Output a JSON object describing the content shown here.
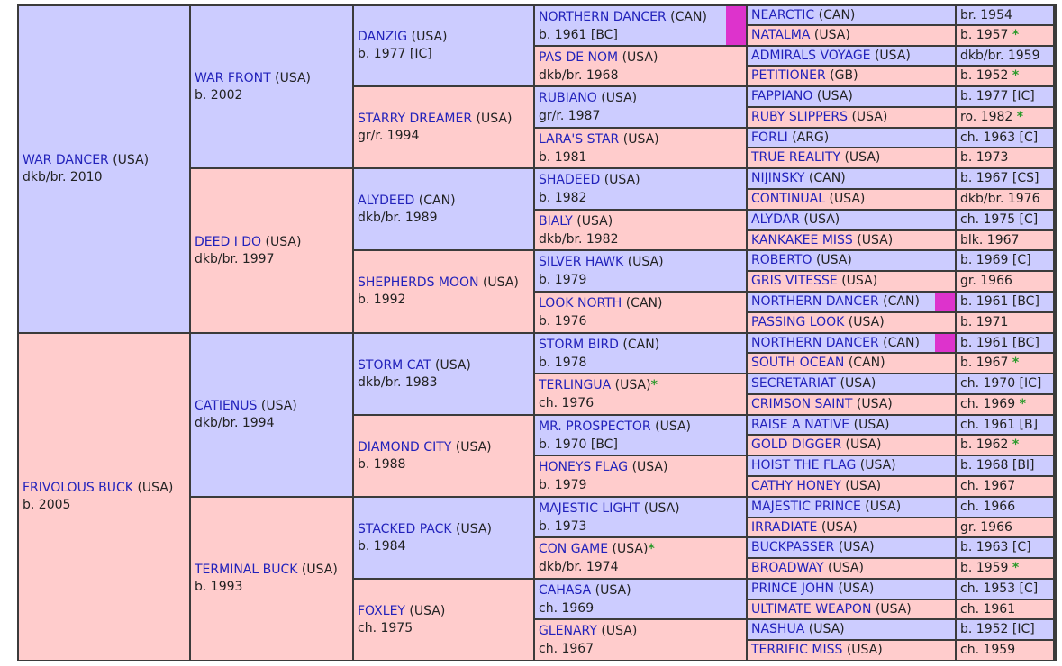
{
  "colors": {
    "male": "#ccccff",
    "female": "#ffcccc",
    "name": "#2222bb",
    "star": "#2a9a2a",
    "inbreed_marker": "#dd33cc",
    "grid": "#3b3b3b"
  },
  "pedigree": {
    "gen1": [
      {
        "name": "WAR DANCER",
        "country": "(USA)",
        "info": "dkb/br. 2010",
        "sex": "m"
      },
      {
        "name": "FRIVOLOUS BUCK",
        "country": "(USA)",
        "info": "b. 2005",
        "sex": "f"
      }
    ],
    "gen2": [
      {
        "name": "WAR FRONT",
        "country": "(USA)",
        "info": "b. 2002",
        "sex": "m"
      },
      {
        "name": "DEED I DO",
        "country": "(USA)",
        "info": "dkb/br. 1997",
        "sex": "f"
      },
      {
        "name": "CATIENUS",
        "country": "(USA)",
        "info": "dkb/br. 1994",
        "sex": "m"
      },
      {
        "name": "TERMINAL BUCK",
        "country": "(USA)",
        "info": "b. 1993",
        "sex": "f"
      }
    ],
    "gen3": [
      {
        "name": "DANZIG",
        "country": "(USA)",
        "info": "b. 1977 [IC]",
        "sex": "m"
      },
      {
        "name": "STARRY DREAMER",
        "country": "(USA)",
        "info": "gr/r. 1994",
        "sex": "f"
      },
      {
        "name": "ALYDEED",
        "country": "(CAN)",
        "info": "dkb/br. 1989",
        "sex": "m"
      },
      {
        "name": "SHEPHERDS MOON",
        "country": "(USA)",
        "info": "b. 1992",
        "sex": "f"
      },
      {
        "name": "STORM CAT",
        "country": "(USA)",
        "info": "dkb/br. 1983",
        "sex": "m"
      },
      {
        "name": "DIAMOND CITY",
        "country": "(USA)",
        "info": "b. 1988",
        "sex": "f"
      },
      {
        "name": "STACKED PACK",
        "country": "(USA)",
        "info": "b. 1984",
        "sex": "m"
      },
      {
        "name": "FOXLEY",
        "country": "(USA)",
        "info": "ch. 1975",
        "sex": "f"
      }
    ],
    "gen4": [
      {
        "name": "NORTHERN DANCER",
        "country": "(CAN)",
        "info": "b. 1961 [BC]",
        "sex": "m",
        "star": "",
        "marker": true
      },
      {
        "name": "PAS DE NOM",
        "country": "(USA)",
        "info": "dkb/br. 1968",
        "sex": "f",
        "star": "",
        "marker": false
      },
      {
        "name": "RUBIANO",
        "country": "(USA)",
        "info": "gr/r. 1987",
        "sex": "m",
        "star": "",
        "marker": false
      },
      {
        "name": "LARA'S STAR",
        "country": "(USA)",
        "info": "b. 1981",
        "sex": "f",
        "star": "",
        "marker": false
      },
      {
        "name": "SHADEED",
        "country": "(USA)",
        "info": "b. 1982",
        "sex": "m",
        "star": "",
        "marker": false
      },
      {
        "name": "BIALY",
        "country": "(USA)",
        "info": "dkb/br. 1982",
        "sex": "f",
        "star": "",
        "marker": false
      },
      {
        "name": "SILVER HAWK",
        "country": "(USA)",
        "info": "b. 1979",
        "sex": "m",
        "star": "",
        "marker": false
      },
      {
        "name": "LOOK NORTH",
        "country": "(CAN)",
        "info": "b. 1976",
        "sex": "f",
        "star": "",
        "marker": false
      },
      {
        "name": "STORM BIRD",
        "country": "(CAN)",
        "info": "b. 1978",
        "sex": "m",
        "star": "",
        "marker": false
      },
      {
        "name": "TERLINGUA",
        "country": "(USA)",
        "info": "ch. 1976",
        "sex": "f",
        "star": "*",
        "marker": false
      },
      {
        "name": "MR. PROSPECTOR",
        "country": "(USA)",
        "info": "b. 1970 [BC]",
        "sex": "m",
        "star": "",
        "marker": false
      },
      {
        "name": "HONEYS FLAG",
        "country": "(USA)",
        "info": "b. 1979",
        "sex": "f",
        "star": "",
        "marker": false
      },
      {
        "name": "MAJESTIC LIGHT",
        "country": "(USA)",
        "info": "b. 1973",
        "sex": "m",
        "star": "",
        "marker": false
      },
      {
        "name": "CON GAME",
        "country": "(USA)",
        "info": "dkb/br. 1974",
        "sex": "f",
        "star": "*",
        "marker": false
      },
      {
        "name": "CAHASA",
        "country": "(USA)",
        "info": "ch. 1969",
        "sex": "m",
        "star": "",
        "marker": false
      },
      {
        "name": "GLENARY",
        "country": "(USA)",
        "info": "ch. 1967",
        "sex": "f",
        "star": "",
        "marker": false
      }
    ],
    "gen5": [
      {
        "name": "NEARCTIC",
        "country": "(CAN)",
        "info": "br. 1954",
        "sex": "m",
        "star": "",
        "marker": false
      },
      {
        "name": "NATALMA",
        "country": "(USA)",
        "info": "b. 1957",
        "sex": "f",
        "star": "*",
        "marker": false
      },
      {
        "name": "ADMIRALS VOYAGE",
        "country": "(USA)",
        "info": "dkb/br. 1959",
        "sex": "m",
        "star": "",
        "marker": false
      },
      {
        "name": "PETITIONER",
        "country": "(GB)",
        "info": "b. 1952",
        "sex": "f",
        "star": "*",
        "marker": false
      },
      {
        "name": "FAPPIANO",
        "country": "(USA)",
        "info": "b. 1977 [IC]",
        "sex": "m",
        "star": "",
        "marker": false
      },
      {
        "name": "RUBY SLIPPERS",
        "country": "(USA)",
        "info": "ro. 1982",
        "sex": "f",
        "star": "*",
        "marker": false
      },
      {
        "name": "FORLI",
        "country": "(ARG)",
        "info": "ch. 1963 [C]",
        "sex": "m",
        "star": "",
        "marker": false
      },
      {
        "name": "TRUE REALITY",
        "country": "(USA)",
        "info": "b. 1973",
        "sex": "f",
        "star": "",
        "marker": false
      },
      {
        "name": "NIJINSKY",
        "country": "(CAN)",
        "info": "b. 1967 [CS]",
        "sex": "m",
        "star": "",
        "marker": false
      },
      {
        "name": "CONTINUAL",
        "country": "(USA)",
        "info": "dkb/br. 1976",
        "sex": "f",
        "star": "",
        "marker": false
      },
      {
        "name": "ALYDAR",
        "country": "(USA)",
        "info": "ch. 1975 [C]",
        "sex": "m",
        "star": "",
        "marker": false
      },
      {
        "name": "KANKAKEE MISS",
        "country": "(USA)",
        "info": "blk. 1967",
        "sex": "f",
        "star": "",
        "marker": false
      },
      {
        "name": "ROBERTO",
        "country": "(USA)",
        "info": "b. 1969 [C]",
        "sex": "m",
        "star": "",
        "marker": false
      },
      {
        "name": "GRIS VITESSE",
        "country": "(USA)",
        "info": "gr. 1966",
        "sex": "f",
        "star": "",
        "marker": false
      },
      {
        "name": "NORTHERN DANCER",
        "country": "(CAN)",
        "info": "b. 1961 [BC]",
        "sex": "m",
        "star": "",
        "marker": true
      },
      {
        "name": "PASSING LOOK",
        "country": "(USA)",
        "info": "b. 1971",
        "sex": "f",
        "star": "",
        "marker": false
      },
      {
        "name": "NORTHERN DANCER",
        "country": "(CAN)",
        "info": "b. 1961 [BC]",
        "sex": "m",
        "star": "",
        "marker": true
      },
      {
        "name": "SOUTH OCEAN",
        "country": "(CAN)",
        "info": "b. 1967",
        "sex": "f",
        "star": "*",
        "marker": false
      },
      {
        "name": "SECRETARIAT",
        "country": "(USA)",
        "info": "ch. 1970 [IC]",
        "sex": "m",
        "star": "",
        "marker": false
      },
      {
        "name": "CRIMSON SAINT",
        "country": "(USA)",
        "info": "ch. 1969",
        "sex": "f",
        "star": "*",
        "marker": false
      },
      {
        "name": "RAISE A NATIVE",
        "country": "(USA)",
        "info": "ch. 1961 [B]",
        "sex": "m",
        "star": "",
        "marker": false
      },
      {
        "name": "GOLD DIGGER",
        "country": "(USA)",
        "info": "b. 1962",
        "sex": "f",
        "star": "*",
        "marker": false
      },
      {
        "name": "HOIST THE FLAG",
        "country": "(USA)",
        "info": "b. 1968 [BI]",
        "sex": "m",
        "star": "",
        "marker": false
      },
      {
        "name": "CATHY HONEY",
        "country": "(USA)",
        "info": "ch. 1967",
        "sex": "f",
        "star": "",
        "marker": false
      },
      {
        "name": "MAJESTIC PRINCE",
        "country": "(USA)",
        "info": "ch. 1966",
        "sex": "m",
        "star": "",
        "marker": false
      },
      {
        "name": "IRRADIATE",
        "country": "(USA)",
        "info": "gr. 1966",
        "sex": "f",
        "star": "",
        "marker": false
      },
      {
        "name": "BUCKPASSER",
        "country": "(USA)",
        "info": "b. 1963 [C]",
        "sex": "m",
        "star": "",
        "marker": false
      },
      {
        "name": "BROADWAY",
        "country": "(USA)",
        "info": "b. 1959",
        "sex": "f",
        "star": "*",
        "marker": false
      },
      {
        "name": "PRINCE JOHN",
        "country": "(USA)",
        "info": "ch. 1953 [C]",
        "sex": "m",
        "star": "",
        "marker": false
      },
      {
        "name": "ULTIMATE WEAPON",
        "country": "(USA)",
        "info": "ch. 1961",
        "sex": "f",
        "star": "",
        "marker": false
      },
      {
        "name": "NASHUA",
        "country": "(USA)",
        "info": "b. 1952 [IC]",
        "sex": "m",
        "star": "",
        "marker": false
      },
      {
        "name": "TERRIFIC MISS",
        "country": "(USA)",
        "info": "ch. 1959",
        "sex": "f",
        "star": "",
        "marker": false
      }
    ]
  }
}
